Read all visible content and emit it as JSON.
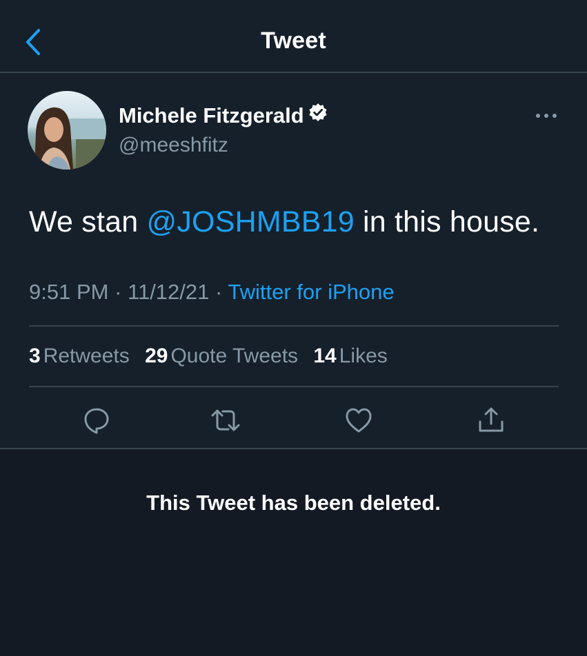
{
  "header": {
    "title": "Tweet",
    "back_icon": "chevron-left-icon"
  },
  "tweet": {
    "author_name": "Michele Fitzgerald",
    "handle": "@meeshfitz",
    "verified_icon": "verified-badge-icon",
    "more_icon": "more-dots-icon",
    "text_before": "We stan ",
    "mention": "@JOSHMBB19",
    "text_after": " in this house.",
    "time": "9:51 PM",
    "date": "11/12/21",
    "separator": " · ",
    "source": "Twitter for iPhone",
    "stats": {
      "retweets_count": "3",
      "retweets_label": "Retweets",
      "quotes_count": "29",
      "quotes_label": "Quote Tweets",
      "likes_count": "14",
      "likes_label": "Likes"
    },
    "actions": [
      "reply-icon",
      "retweet-icon",
      "like-icon",
      "share-icon"
    ]
  },
  "deleted_notice": "This Tweet has been deleted.",
  "colors": {
    "background": "#15202b",
    "accent": "#1da1f2",
    "secondary_text": "#8899a6",
    "divider": "#38444d"
  }
}
